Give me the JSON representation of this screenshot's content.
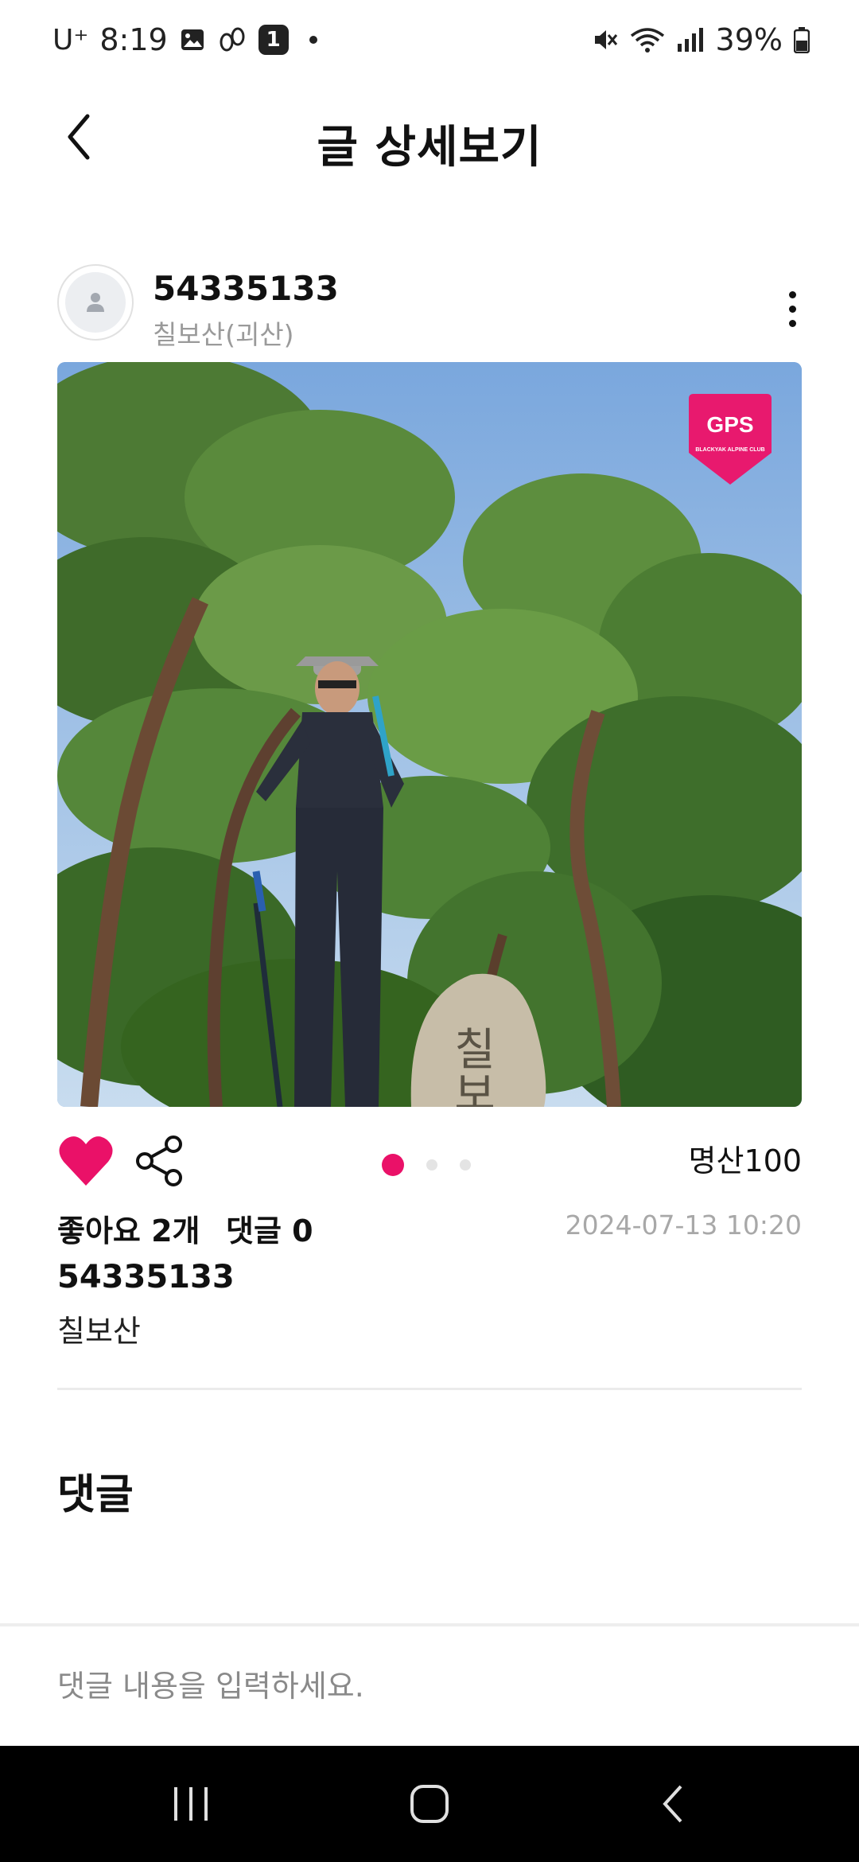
{
  "status_bar": {
    "carrier": "U⁺",
    "time": "8:19",
    "notification_count": "1",
    "battery": "39%"
  },
  "header": {
    "title": "글 상세보기"
  },
  "post": {
    "author": "54335133",
    "mountain": "칠보산(괴산)",
    "gps_badge_label": "GPS",
    "gps_badge_subtitle": "BLACKYAK ALPINE CLUB",
    "photo_count": 3,
    "active_photo_index": 0,
    "mountain_tag": "명산100",
    "likes_label": "좋아요 2개",
    "comments_label": "댓글 0",
    "date": "2024-07-13 10:20",
    "username": "54335133",
    "body": "칠보산",
    "stone_text": "칠보"
  },
  "comments": {
    "title": "댓글",
    "input_placeholder": "댓글 내용을 입력하세요."
  },
  "colors": {
    "accent": "#ea1168",
    "muted_text": "#9a9a9a"
  }
}
